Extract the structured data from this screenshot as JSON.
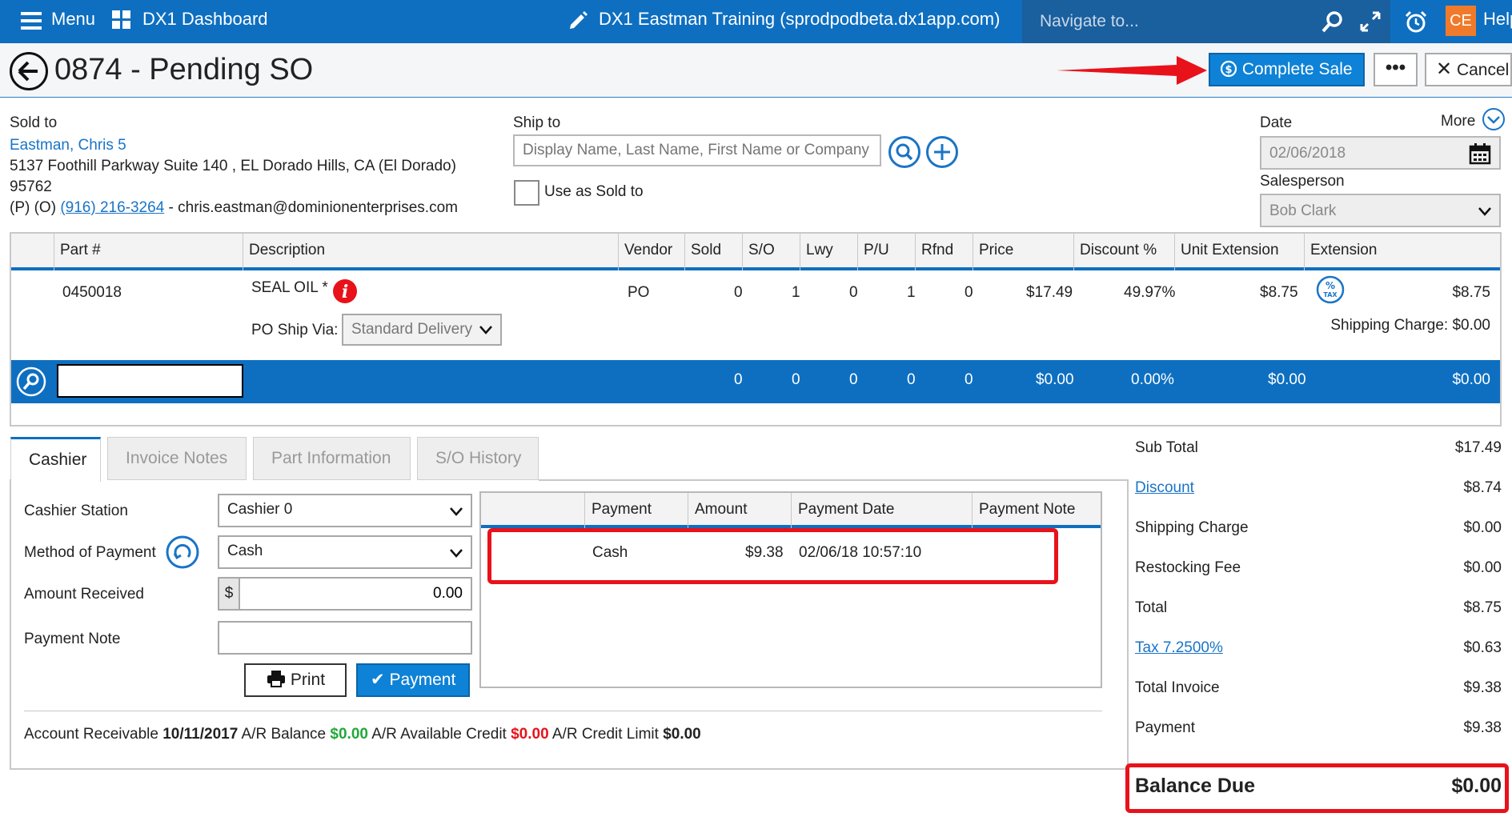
{
  "topbar": {
    "menu_label": "Menu",
    "dashboard_label": "DX1 Dashboard",
    "site_title": "DX1 Eastman Training (sprodpodbeta.dx1app.com)",
    "navigate_placeholder": "Navigate to...",
    "avatar_initials": "CE",
    "help_label": "Help",
    "bar_color": "#0e6fc1"
  },
  "header": {
    "title": "0874 - Pending SO",
    "complete_sale_label": "Complete Sale",
    "more_label": "•••",
    "cancel_label": "Cancel"
  },
  "sold_to": {
    "label": "Sold to",
    "name": "Eastman, Chris 5",
    "address": "5137 Foothill Parkway Suite 140 , EL Dorado Hills, CA (El Dorado)",
    "zip": "95762",
    "phone_prefix": "(P) (O)",
    "phone": "(916) 216-3264",
    "email": "- chris.eastman@dominionenterprises.com"
  },
  "ship_to": {
    "label": "Ship to",
    "placeholder": "Display Name, Last Name, First Name or Company",
    "use_as_sold_to": "Use as Sold to"
  },
  "date_section": {
    "date_label": "Date",
    "more_label": "More",
    "date_value": "02/06/2018",
    "salesperson_label": "Salesperson",
    "salesperson_value": "Bob Clark"
  },
  "parts_table": {
    "headers": [
      "Part #",
      "Description",
      "Vendor",
      "Sold",
      "S/O",
      "Lwy",
      "P/U",
      "Rfnd",
      "Price",
      "Discount %",
      "Unit Extension",
      "Extension"
    ],
    "row": {
      "part": "0450018",
      "description": "SEAL OIL *",
      "vendor": "PO",
      "sold": "0",
      "so": "1",
      "lwy": "0",
      "pu": "1",
      "rfnd": "0",
      "price": "$17.49",
      "discount": "49.97%",
      "unit_ext": "$8.75",
      "extension": "$8.75",
      "ship_via_label": "PO Ship Via:",
      "ship_via_value": "Standard Delivery",
      "shipping_charge": "Shipping Charge: $0.00"
    },
    "totals": {
      "sold": "0",
      "so": "0",
      "lwy": "0",
      "pu": "0",
      "rfnd": "0",
      "price": "$0.00",
      "discount": "0.00%",
      "unit_ext": "$0.00",
      "extension": "$0.00"
    }
  },
  "tabs": [
    "Cashier",
    "Invoice Notes",
    "Part Information",
    "S/O History"
  ],
  "cashier": {
    "station_label": "Cashier Station",
    "station_value": "Cashier 0",
    "method_label": "Method of Payment",
    "method_value": "Cash",
    "amount_label": "Amount Received",
    "currency": "$",
    "amount_value": "0.00",
    "note_label": "Payment Note",
    "print_label": "Print",
    "payment_label": "Payment"
  },
  "payments_grid": {
    "headers": [
      "Payment",
      "Amount",
      "Payment Date",
      "Payment Note"
    ],
    "rows": [
      {
        "payment": "Cash",
        "amount": "$9.38",
        "date": "02/06/18 10:57:10",
        "note": ""
      }
    ]
  },
  "ar": {
    "label": "Account Receivable",
    "date": "10/11/2017",
    "balance_label": "A/R Balance",
    "balance": "$0.00",
    "avail_label": "A/R Available Credit",
    "avail": "$0.00",
    "limit_label": "A/R Credit Limit",
    "limit": "$0.00",
    "green": "#22a83a",
    "red": "#e8121a"
  },
  "summary": {
    "sub_total_label": "Sub Total",
    "sub_total": "$17.49",
    "discount_label": "Discount",
    "discount": "$8.74",
    "shipping_label": "Shipping Charge",
    "shipping": "$0.00",
    "restocking_label": "Restocking Fee",
    "restocking": "$0.00",
    "total_label": "Total",
    "total": "$8.75",
    "tax_label": "Tax 7.2500%",
    "tax": "$0.63",
    "total_invoice_label": "Total Invoice",
    "total_invoice": "$9.38",
    "payment_label": "Payment",
    "payment": "$9.38",
    "balance_due_label": "Balance Due",
    "balance_due": "$0.00"
  }
}
